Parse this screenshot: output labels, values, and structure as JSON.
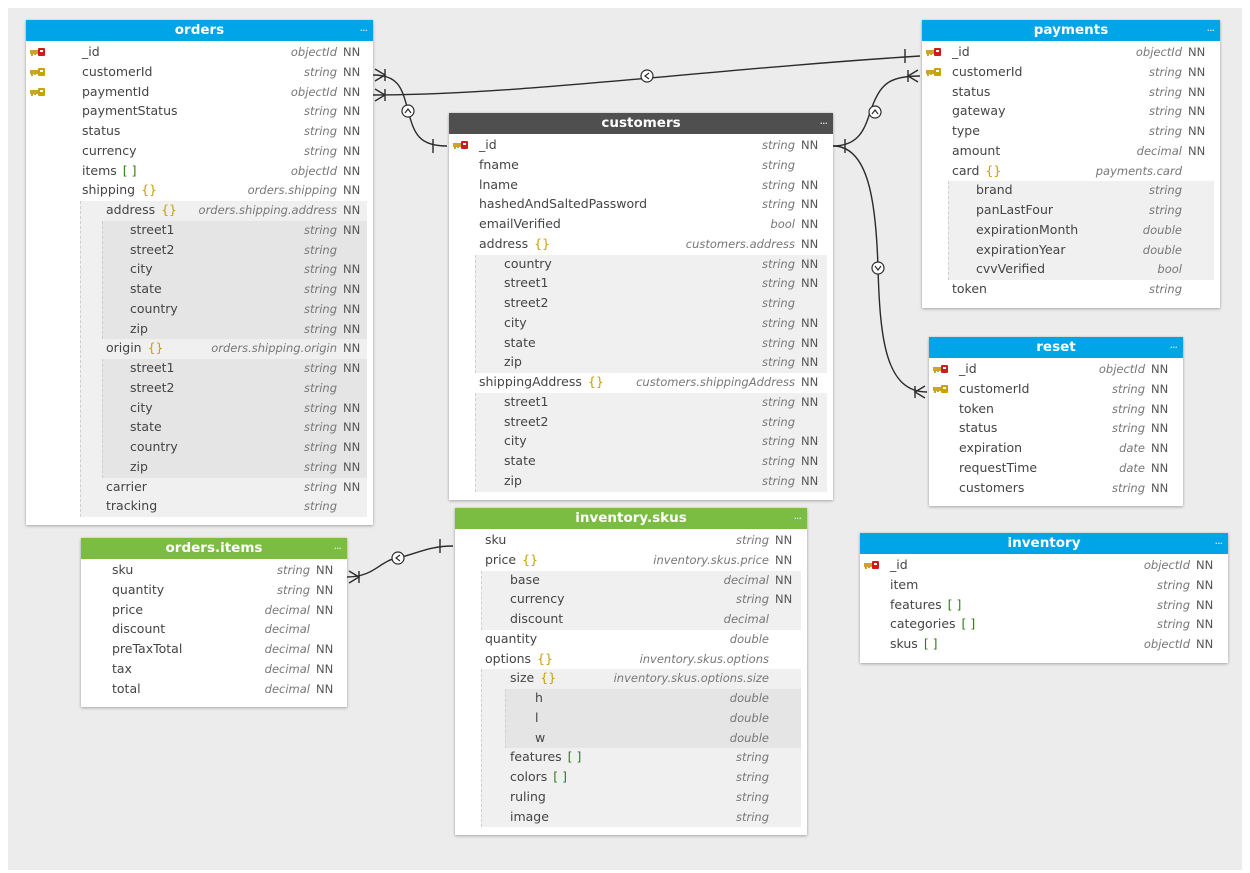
{
  "tables": [
    {
      "id": "orders",
      "title": "orders",
      "menu": "...",
      "color": "#00a5e7",
      "fields": [
        {
          "name": "_id",
          "type": "objectId",
          "nn": "NN",
          "icon": "primary-key-icon",
          "marker": "",
          "level": 0
        },
        {
          "name": "customerId",
          "type": "string",
          "nn": "NN",
          "icon": "foreign-key-icon",
          "marker": "",
          "level": 0
        },
        {
          "name": "paymentId",
          "type": "objectId",
          "nn": "NN",
          "icon": "foreign-key-icon",
          "marker": "",
          "level": 0
        },
        {
          "name": "paymentStatus",
          "type": "string",
          "nn": "NN",
          "icon": "",
          "marker": "",
          "level": 0
        },
        {
          "name": "status",
          "type": "string",
          "nn": "NN",
          "icon": "",
          "marker": "",
          "level": 0
        },
        {
          "name": "currency",
          "type": "string",
          "nn": "NN",
          "icon": "",
          "marker": "",
          "level": 0
        },
        {
          "name": "items",
          "type": "objectId",
          "nn": "NN",
          "icon": "",
          "marker": "[ ]",
          "level": 0
        },
        {
          "name": "shipping",
          "type": "orders.shipping",
          "nn": "NN",
          "icon": "",
          "marker": "{}",
          "level": 0
        },
        {
          "name": "address",
          "type": "orders.shipping.address",
          "nn": "NN",
          "icon": "",
          "marker": "{}",
          "level": 1
        },
        {
          "name": "street1",
          "type": "string",
          "nn": "NN",
          "icon": "",
          "marker": "",
          "level": 2
        },
        {
          "name": "street2",
          "type": "string",
          "nn": "",
          "icon": "",
          "marker": "",
          "level": 2
        },
        {
          "name": "city",
          "type": "string",
          "nn": "NN",
          "icon": "",
          "marker": "",
          "level": 2
        },
        {
          "name": "state",
          "type": "string",
          "nn": "NN",
          "icon": "",
          "marker": "",
          "level": 2
        },
        {
          "name": "country",
          "type": "string",
          "nn": "NN",
          "icon": "",
          "marker": "",
          "level": 2
        },
        {
          "name": "zip",
          "type": "string",
          "nn": "NN",
          "icon": "",
          "marker": "",
          "level": 2
        },
        {
          "name": "origin",
          "type": "orders.shipping.origin",
          "nn": "NN",
          "icon": "",
          "marker": "{}",
          "level": 1
        },
        {
          "name": "street1",
          "type": "string",
          "nn": "NN",
          "icon": "",
          "marker": "",
          "level": 2
        },
        {
          "name": "street2",
          "type": "string",
          "nn": "",
          "icon": "",
          "marker": "",
          "level": 2
        },
        {
          "name": "city",
          "type": "string",
          "nn": "NN",
          "icon": "",
          "marker": "",
          "level": 2
        },
        {
          "name": "state",
          "type": "string",
          "nn": "NN",
          "icon": "",
          "marker": "",
          "level": 2
        },
        {
          "name": "country",
          "type": "string",
          "nn": "NN",
          "icon": "",
          "marker": "",
          "level": 2
        },
        {
          "name": "zip",
          "type": "string",
          "nn": "NN",
          "icon": "",
          "marker": "",
          "level": 2
        },
        {
          "name": "carrier",
          "type": "string",
          "nn": "NN",
          "icon": "",
          "marker": "",
          "level": 1
        },
        {
          "name": "tracking",
          "type": "string",
          "nn": "",
          "icon": "",
          "marker": "",
          "level": 1
        }
      ]
    },
    {
      "id": "customers",
      "title": "customers",
      "menu": "...",
      "color": "#4f4f4f",
      "fields": [
        {
          "name": "_id",
          "type": "string",
          "nn": "NN",
          "icon": "primary-key-icon",
          "marker": "",
          "level": 0
        },
        {
          "name": "fname",
          "type": "string",
          "nn": "",
          "icon": "",
          "marker": "",
          "level": 0
        },
        {
          "name": "lname",
          "type": "string",
          "nn": "NN",
          "icon": "",
          "marker": "",
          "level": 0
        },
        {
          "name": "hashedAndSaltedPassword",
          "type": "string",
          "nn": "NN",
          "icon": "",
          "marker": "",
          "level": 0
        },
        {
          "name": "emailVerified",
          "type": "bool",
          "nn": "NN",
          "icon": "",
          "marker": "",
          "level": 0
        },
        {
          "name": "address",
          "type": "customers.address",
          "nn": "NN",
          "icon": "",
          "marker": "{}",
          "level": 0
        },
        {
          "name": "country",
          "type": "string",
          "nn": "NN",
          "icon": "",
          "marker": "",
          "level": 1
        },
        {
          "name": "street1",
          "type": "string",
          "nn": "NN",
          "icon": "",
          "marker": "",
          "level": 1
        },
        {
          "name": "street2",
          "type": "string",
          "nn": "",
          "icon": "",
          "marker": "",
          "level": 1
        },
        {
          "name": "city",
          "type": "string",
          "nn": "NN",
          "icon": "",
          "marker": "",
          "level": 1
        },
        {
          "name": "state",
          "type": "string",
          "nn": "NN",
          "icon": "",
          "marker": "",
          "level": 1
        },
        {
          "name": "zip",
          "type": "string",
          "nn": "NN",
          "icon": "",
          "marker": "",
          "level": 1
        },
        {
          "name": "shippingAddress",
          "type": "customers.shippingAddress",
          "nn": "NN",
          "icon": "",
          "marker": "{}",
          "level": 0
        },
        {
          "name": "street1",
          "type": "string",
          "nn": "NN",
          "icon": "",
          "marker": "",
          "level": 1
        },
        {
          "name": "street2",
          "type": "string",
          "nn": "",
          "icon": "",
          "marker": "",
          "level": 1
        },
        {
          "name": "city",
          "type": "string",
          "nn": "NN",
          "icon": "",
          "marker": "",
          "level": 1
        },
        {
          "name": "state",
          "type": "string",
          "nn": "NN",
          "icon": "",
          "marker": "",
          "level": 1
        },
        {
          "name": "zip",
          "type": "string",
          "nn": "NN",
          "icon": "",
          "marker": "",
          "level": 1
        }
      ]
    },
    {
      "id": "payments",
      "title": "payments",
      "menu": "...",
      "color": "#00a5e7",
      "fields": [
        {
          "name": "_id",
          "type": "objectId",
          "nn": "NN",
          "icon": "primary-key-icon",
          "marker": "",
          "level": 0
        },
        {
          "name": "customerId",
          "type": "string",
          "nn": "NN",
          "icon": "foreign-key-icon",
          "marker": "",
          "level": 0
        },
        {
          "name": "status",
          "type": "string",
          "nn": "NN",
          "icon": "",
          "marker": "",
          "level": 0
        },
        {
          "name": "gateway",
          "type": "string",
          "nn": "NN",
          "icon": "",
          "marker": "",
          "level": 0
        },
        {
          "name": "type",
          "type": "string",
          "nn": "NN",
          "icon": "",
          "marker": "",
          "level": 0
        },
        {
          "name": "amount",
          "type": "decimal",
          "nn": "NN",
          "icon": "",
          "marker": "",
          "level": 0
        },
        {
          "name": "card",
          "type": "payments.card",
          "nn": "",
          "icon": "",
          "marker": "{}",
          "level": 0
        },
        {
          "name": "brand",
          "type": "string",
          "nn": "",
          "icon": "",
          "marker": "",
          "level": 1
        },
        {
          "name": "panLastFour",
          "type": "string",
          "nn": "",
          "icon": "",
          "marker": "",
          "level": 1
        },
        {
          "name": "expirationMonth",
          "type": "double",
          "nn": "",
          "icon": "",
          "marker": "",
          "level": 1
        },
        {
          "name": "expirationYear",
          "type": "double",
          "nn": "",
          "icon": "",
          "marker": "",
          "level": 1
        },
        {
          "name": "cvvVerified",
          "type": "bool",
          "nn": "",
          "icon": "",
          "marker": "",
          "level": 1
        },
        {
          "name": "token",
          "type": "string",
          "nn": "",
          "icon": "",
          "marker": "",
          "level": 0
        }
      ]
    },
    {
      "id": "reset",
      "title": "reset",
      "menu": "...",
      "color": "#00a5e7",
      "fields": [
        {
          "name": "_id",
          "type": "objectId",
          "nn": "NN",
          "icon": "primary-key-icon",
          "marker": "",
          "level": 0
        },
        {
          "name": "customerId",
          "type": "string",
          "nn": "NN",
          "icon": "foreign-key-icon",
          "marker": "",
          "level": 0
        },
        {
          "name": "token",
          "type": "string",
          "nn": "NN",
          "icon": "",
          "marker": "",
          "level": 0
        },
        {
          "name": "status",
          "type": "string",
          "nn": "NN",
          "icon": "",
          "marker": "",
          "level": 0
        },
        {
          "name": "expiration",
          "type": "date",
          "nn": "NN",
          "icon": "",
          "marker": "",
          "level": 0
        },
        {
          "name": "requestTime",
          "type": "date",
          "nn": "NN",
          "icon": "",
          "marker": "",
          "level": 0
        },
        {
          "name": "customers",
          "type": "string",
          "nn": "NN",
          "icon": "",
          "marker": "",
          "level": 0
        }
      ]
    },
    {
      "id": "orders_items",
      "title": "orders.items",
      "menu": "...",
      "color": "#7bbd42",
      "fields": [
        {
          "name": "sku",
          "type": "string",
          "nn": "NN",
          "icon": "",
          "marker": "",
          "level": 0
        },
        {
          "name": "quantity",
          "type": "string",
          "nn": "NN",
          "icon": "",
          "marker": "",
          "level": 0
        },
        {
          "name": "price",
          "type": "decimal",
          "nn": "NN",
          "icon": "",
          "marker": "",
          "level": 0
        },
        {
          "name": "discount",
          "type": "decimal",
          "nn": "",
          "icon": "",
          "marker": "",
          "level": 0
        },
        {
          "name": "preTaxTotal",
          "type": "decimal",
          "nn": "NN",
          "icon": "",
          "marker": "",
          "level": 0
        },
        {
          "name": "tax",
          "type": "decimal",
          "nn": "NN",
          "icon": "",
          "marker": "",
          "level": 0
        },
        {
          "name": "total",
          "type": "decimal",
          "nn": "NN",
          "icon": "",
          "marker": "",
          "level": 0
        }
      ]
    },
    {
      "id": "inventory_skus",
      "title": "inventory.skus",
      "menu": "...",
      "color": "#7bbd42",
      "fields": [
        {
          "name": "sku",
          "type": "string",
          "nn": "NN",
          "icon": "",
          "marker": "",
          "level": 0
        },
        {
          "name": "price",
          "type": "inventory.skus.price",
          "nn": "NN",
          "icon": "",
          "marker": "{}",
          "level": 0
        },
        {
          "name": "base",
          "type": "decimal",
          "nn": "NN",
          "icon": "",
          "marker": "",
          "level": 1
        },
        {
          "name": "currency",
          "type": "string",
          "nn": "NN",
          "icon": "",
          "marker": "",
          "level": 1
        },
        {
          "name": "discount",
          "type": "decimal",
          "nn": "",
          "icon": "",
          "marker": "",
          "level": 1
        },
        {
          "name": "quantity",
          "type": "double",
          "nn": "",
          "icon": "",
          "marker": "",
          "level": 0
        },
        {
          "name": "options",
          "type": "inventory.skus.options",
          "nn": "",
          "icon": "",
          "marker": "{}",
          "level": 0
        },
        {
          "name": "size",
          "type": "inventory.skus.options.size",
          "nn": "",
          "icon": "",
          "marker": "{}",
          "level": 1
        },
        {
          "name": "h",
          "type": "double",
          "nn": "",
          "icon": "",
          "marker": "",
          "level": 2
        },
        {
          "name": "l",
          "type": "double",
          "nn": "",
          "icon": "",
          "marker": "",
          "level": 2
        },
        {
          "name": "w",
          "type": "double",
          "nn": "",
          "icon": "",
          "marker": "",
          "level": 2
        },
        {
          "name": "features",
          "type": "string",
          "nn": "",
          "icon": "",
          "marker": "[ ]",
          "level": 1
        },
        {
          "name": "colors",
          "type": "string",
          "nn": "",
          "icon": "",
          "marker": "[ ]",
          "level": 1
        },
        {
          "name": "ruling",
          "type": "string",
          "nn": "",
          "icon": "",
          "marker": "",
          "level": 1
        },
        {
          "name": "image",
          "type": "string",
          "nn": "",
          "icon": "",
          "marker": "",
          "level": 1
        }
      ]
    },
    {
      "id": "inventory",
      "title": "inventory",
      "menu": "...",
      "color": "#00a5e7",
      "fields": [
        {
          "name": "_id",
          "type": "objectId",
          "nn": "NN",
          "icon": "primary-key-icon",
          "marker": "",
          "level": 0
        },
        {
          "name": "item",
          "type": "string",
          "nn": "NN",
          "icon": "",
          "marker": "",
          "level": 0
        },
        {
          "name": "features",
          "type": "string",
          "nn": "NN",
          "icon": "",
          "marker": "[ ]",
          "level": 0
        },
        {
          "name": "categories",
          "type": "string",
          "nn": "NN",
          "icon": "",
          "marker": "[ ]",
          "level": 0
        },
        {
          "name": "skus",
          "type": "objectId",
          "nn": "NN",
          "icon": "",
          "marker": "[ ]",
          "level": 0
        }
      ]
    }
  ]
}
